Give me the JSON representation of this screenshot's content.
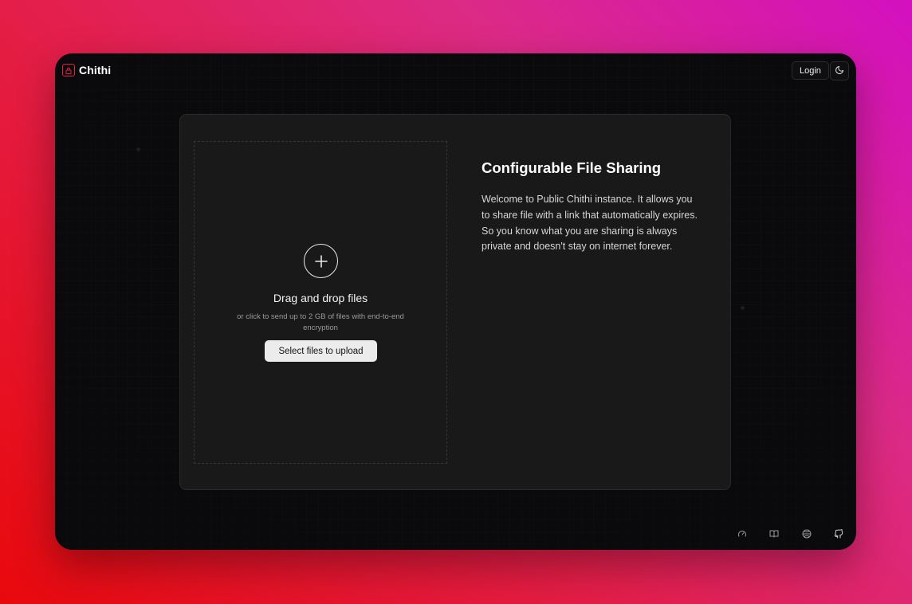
{
  "header": {
    "brand_name": "Chithi",
    "login_label": "Login",
    "theme_icon": "moon-icon"
  },
  "upload": {
    "add_icon": "plus-icon",
    "title": "Drag and drop files",
    "subtitle": "or click to send up to 2 GB of files with end-to-end encryption",
    "button_label": "Select files to upload"
  },
  "info": {
    "title": "Configurable File Sharing",
    "body": "Welcome to Public Chithi instance. It allows you to share file with a link that automatically expires. So you know what you are sharing is always private and doesn't stay on internet forever."
  },
  "footer": {
    "icons": [
      "gauge-icon",
      "book-icon",
      "globe-icon",
      "github-icon"
    ]
  },
  "colors": {
    "accent": "#e11d48",
    "window_bg": "#0a0a0c",
    "card_bg": "#191919",
    "button_bg": "#ececec"
  }
}
